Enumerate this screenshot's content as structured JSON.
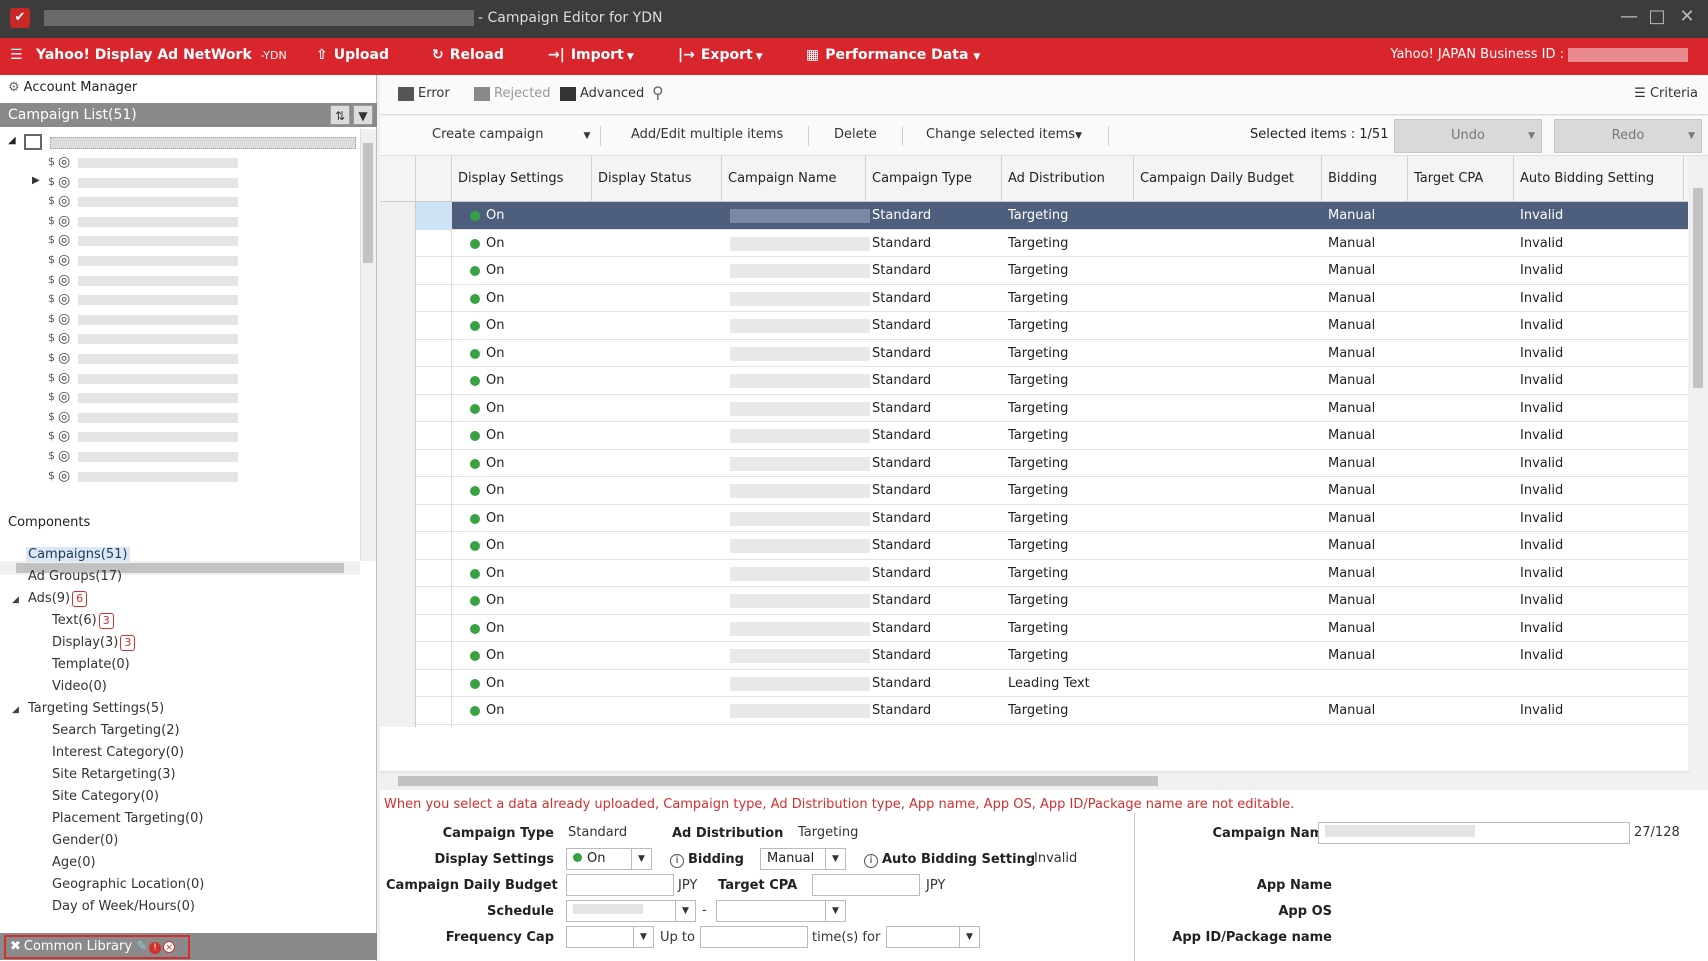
{
  "window": {
    "title": "- Campaign Editor for YDN",
    "controls": [
      "minimize-icon",
      "maximize-icon",
      "close-icon"
    ]
  },
  "toolbar": {
    "brand": "Yahoo! Display Ad NetWork",
    "brand_suffix": "-YDN",
    "upload": "Upload",
    "reload": "Reload",
    "import": "Import",
    "export": "Export",
    "performance": "Performance Data",
    "business_id_label": "Yahoo! JAPAN Business ID :"
  },
  "left": {
    "account_manager": "Account Manager",
    "campaign_list": "Campaign List(51)",
    "components_title": "Components",
    "components": {
      "campaigns": "Campaigns(51)",
      "ad_groups": "Ad Groups(17)",
      "ads": "Ads(9)",
      "ads_badge": "6",
      "text": "Text(6)",
      "text_badge": "3",
      "display": "Display(3)",
      "display_badge": "3",
      "template": "Template(0)",
      "video": "Video(0)",
      "targeting": "Targeting Settings(5)",
      "search_targeting": "Search Targeting(2)",
      "interest_category": "Interest Category(0)",
      "site_retargeting": "Site Retargeting(3)",
      "site_category": "Site Category(0)",
      "placement_targeting": "Placement Targeting(0)",
      "gender": "Gender(0)",
      "age": "Age(0)",
      "geographic_location": "Geographic Location(0)",
      "day_of_week": "Day of Week/Hours(0)"
    },
    "common_library": "Common Library"
  },
  "errbar": {
    "error": "Error",
    "rejected": "Rejected",
    "advanced": "Advanced",
    "criteria": "Criteria"
  },
  "actions": {
    "create_campaign": "Create campaign",
    "add_edit_multiple": "Add/Edit multiple items",
    "delete": "Delete",
    "change_selected": "Change selected items",
    "selected_items": "Selected items : 1/51",
    "undo": "Undo",
    "redo": "Redo"
  },
  "grid": {
    "columns": [
      "Display Settings",
      "Display Status",
      "Campaign Name",
      "Campaign Type",
      "Ad Distribution",
      "Campaign Daily Budget",
      "Bidding",
      "Target CPA",
      "Auto Bidding Setting"
    ],
    "rows": [
      {
        "display": "On",
        "type": "Standard",
        "dist": "Targeting",
        "bidding": "Manual",
        "auto": "Invalid"
      },
      {
        "display": "On",
        "type": "Standard",
        "dist": "Targeting",
        "bidding": "Manual",
        "auto": "Invalid"
      },
      {
        "display": "On",
        "type": "Standard",
        "dist": "Targeting",
        "bidding": "Manual",
        "auto": "Invalid"
      },
      {
        "display": "On",
        "type": "Standard",
        "dist": "Targeting",
        "bidding": "Manual",
        "auto": "Invalid"
      },
      {
        "display": "On",
        "type": "Standard",
        "dist": "Targeting",
        "bidding": "Manual",
        "auto": "Invalid"
      },
      {
        "display": "On",
        "type": "Standard",
        "dist": "Targeting",
        "bidding": "Manual",
        "auto": "Invalid"
      },
      {
        "display": "On",
        "type": "Standard",
        "dist": "Targeting",
        "bidding": "Manual",
        "auto": "Invalid"
      },
      {
        "display": "On",
        "type": "Standard",
        "dist": "Targeting",
        "bidding": "Manual",
        "auto": "Invalid"
      },
      {
        "display": "On",
        "type": "Standard",
        "dist": "Targeting",
        "bidding": "Manual",
        "auto": "Invalid"
      },
      {
        "display": "On",
        "type": "Standard",
        "dist": "Targeting",
        "bidding": "Manual",
        "auto": "Invalid"
      },
      {
        "display": "On",
        "type": "Standard",
        "dist": "Targeting",
        "bidding": "Manual",
        "auto": "Invalid"
      },
      {
        "display": "On",
        "type": "Standard",
        "dist": "Targeting",
        "bidding": "Manual",
        "auto": "Invalid"
      },
      {
        "display": "On",
        "type": "Standard",
        "dist": "Targeting",
        "bidding": "Manual",
        "auto": "Invalid"
      },
      {
        "display": "On",
        "type": "Standard",
        "dist": "Targeting",
        "bidding": "Manual",
        "auto": "Invalid"
      },
      {
        "display": "On",
        "type": "Standard",
        "dist": "Targeting",
        "bidding": "Manual",
        "auto": "Invalid"
      },
      {
        "display": "On",
        "type": "Standard",
        "dist": "Targeting",
        "bidding": "Manual",
        "auto": "Invalid"
      },
      {
        "display": "On",
        "type": "Standard",
        "dist": "Targeting",
        "bidding": "Manual",
        "auto": "Invalid"
      },
      {
        "display": "On",
        "type": "Standard",
        "dist": "Leading Text",
        "bidding": "",
        "auto": ""
      },
      {
        "display": "On",
        "type": "Standard",
        "dist": "Targeting",
        "bidding": "Manual",
        "auto": "Invalid"
      }
    ]
  },
  "detail": {
    "warning": "When you select a data already uploaded, Campaign type, Ad Distribution type, App name, App OS, App ID/Package name are not editable.",
    "campaign_type_label": "Campaign Type",
    "campaign_type_value": "Standard",
    "ad_distribution_label": "Ad Distribution",
    "ad_distribution_value": "Targeting",
    "display_settings_label": "Display Settings",
    "display_settings_value": "On",
    "bidding_label": "Bidding",
    "bidding_value": "Manual",
    "auto_bidding_label": "Auto Bidding Setting",
    "auto_bidding_value": "Invalid",
    "daily_budget_label": "Campaign Daily Budget",
    "jpy1": "JPY",
    "target_cpa_label": "Target CPA",
    "jpy2": "JPY",
    "schedule_label": "Schedule",
    "schedule_sep": "-",
    "frequency_cap_label": "Frequency Cap",
    "up_to": "Up to",
    "times_for": "time(s) for",
    "campaign_name_label": "Campaign Name",
    "campaign_name_count": "27/128",
    "app_name_label": "App Name",
    "app_os_label": "App OS",
    "app_id_label": "App ID/Package name"
  }
}
